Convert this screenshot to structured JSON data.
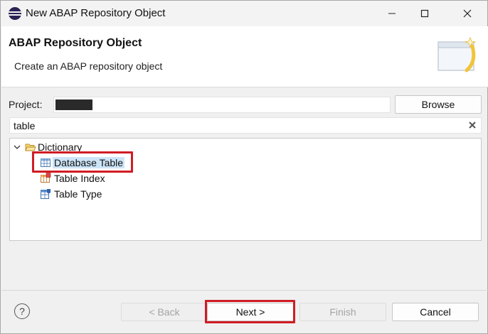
{
  "window": {
    "title": "New ABAP Repository Object",
    "accent": "#d01c24",
    "selection_bg": "#cde4f7"
  },
  "header": {
    "title": "ABAP Repository Object",
    "description": "Create an ABAP repository object",
    "graphic_icon": "wizard-banner-icon"
  },
  "project": {
    "label": "Project:",
    "value_redacted": true,
    "browse_label": "Browse"
  },
  "filter": {
    "value": "table",
    "clear_icon": "clear-icon"
  },
  "tree": {
    "root": {
      "label": "Dictionary",
      "icon": "folder-open-icon",
      "expanded": true
    },
    "children": [
      {
        "label": "Database Table",
        "icon": "database-table-icon",
        "selected": true
      },
      {
        "label": "Table Index",
        "icon": "table-index-icon",
        "selected": false
      },
      {
        "label": "Table Type",
        "icon": "table-type-icon",
        "selected": false
      }
    ]
  },
  "footer": {
    "help_icon": "help-icon",
    "help_glyph": "?",
    "back_label": "< Back",
    "next_label": "Next >",
    "finish_label": "Finish",
    "cancel_label": "Cancel"
  }
}
